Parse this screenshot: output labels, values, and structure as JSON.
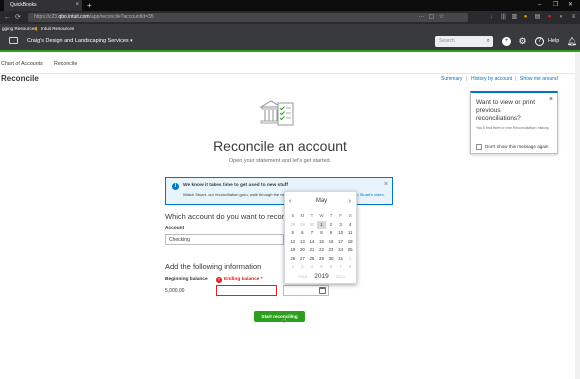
{
  "browser": {
    "tab_title": "QuickBooks",
    "tab_close": "×",
    "new_tab": "+",
    "url_prefix": "https://c23.",
    "url_host": "qbo.intuit.com",
    "url_path": "/app/reconcile?accountId=35",
    "window_controls": [
      "–",
      "❐",
      "✕"
    ],
    "bookmarks": [
      "gging Resources",
      "Intuit Resources"
    ]
  },
  "qb_header": {
    "company_name": "Craig's Design and Landscaping Services",
    "company_caret": "▾",
    "search_placeholder": "Search",
    "help_label": "Help"
  },
  "subnav": {
    "items": [
      "Chart of Accounts",
      "Reconcile"
    ]
  },
  "page": {
    "title": "Reconcile",
    "links": [
      "Summary",
      "History by account",
      "Show me around"
    ],
    "pipe": "|"
  },
  "hero": {
    "title": "Reconcile an account",
    "subtitle": "Open your statement and let's get started."
  },
  "info_banner": {
    "icon": "i",
    "heading": "We know it takes time to get used to new stuff",
    "body": "Watch Stuart, our reconciliation guru, walk through the new... he's doing it better than Stuart.",
    "link": "Watch Stuart's video.",
    "close": "×"
  },
  "account_section": {
    "heading": "Which account do you want to reconc",
    "account_label": "Account",
    "account_value": "Checking"
  },
  "info_section": {
    "heading": "Add the following information",
    "beginning_label": "Beginning balance",
    "beginning_value": "5,000.00",
    "ending_label": "Ending balance *",
    "error_icon": "!"
  },
  "start_button": "Start reconciling",
  "popover": {
    "title": "Want to view or print previous reconciliations?",
    "description": "You'll find them in the Reconciliation history.",
    "checkbox_label": "Don't show this message again",
    "close": "×"
  },
  "datepicker": {
    "month": "May",
    "prev": "‹",
    "next": "›",
    "weekdays": [
      "S",
      "M",
      "T",
      "W",
      "T",
      "F",
      "S"
    ],
    "weeks": [
      [
        "28",
        "29",
        "30",
        "1",
        "2",
        "3",
        "4"
      ],
      [
        "5",
        "6",
        "7",
        "8",
        "9",
        "10",
        "11"
      ],
      [
        "12",
        "13",
        "14",
        "15",
        "16",
        "17",
        "18"
      ],
      [
        "19",
        "20",
        "21",
        "22",
        "23",
        "24",
        "25"
      ],
      [
        "26",
        "27",
        "28",
        "29",
        "30",
        "31",
        "1"
      ],
      [
        "2",
        "3",
        "4",
        "5",
        "6",
        "7",
        "8"
      ]
    ],
    "years": [
      "2018",
      "2019",
      "2020"
    ],
    "current_year": "2019",
    "selected_day": "1"
  },
  "colors": {
    "brand_green": "#2ca01c",
    "link_blue": "#0077c5",
    "error_red": "#e02020",
    "header_dark": "#393a3d"
  }
}
